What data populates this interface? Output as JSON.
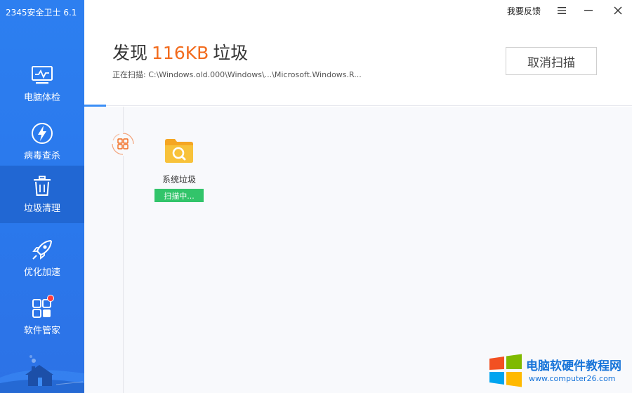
{
  "app": {
    "title": "2345安全卫士 6.1"
  },
  "sidebar": {
    "items": [
      {
        "label": "电脑体检",
        "icon": "monitor-icon",
        "active": false
      },
      {
        "label": "病毒查杀",
        "icon": "lightning-shield-icon",
        "active": false
      },
      {
        "label": "垃圾清理",
        "icon": "trash-icon",
        "active": true
      },
      {
        "label": "优化加速",
        "icon": "rocket-icon",
        "active": false
      },
      {
        "label": "软件管家",
        "icon": "apps-icon",
        "active": false,
        "badge": "red-dot"
      }
    ]
  },
  "titlebar": {
    "feedback": "我要反馈",
    "menu_icon": "hamburger-icon",
    "minimize_icon": "minimize-icon",
    "close_icon": "close-icon"
  },
  "header": {
    "prefix": "发现",
    "size": "116KB",
    "suffix": "垃圾",
    "scan_path": "正在扫描: C:\\Windows.old.000\\Windows\\...\\Microsoft.Windows.R...",
    "cancel_button": "取消扫描"
  },
  "progress": {
    "percent": 4
  },
  "categories": [
    {
      "label": "系统垃圾",
      "status": "扫描中...",
      "icon": "folder-search-icon"
    }
  ],
  "colors": {
    "sidebar": "#2d7ff0",
    "sidebar_active": "#2167d3",
    "accent_orange": "#f26b1d",
    "progress_blue": "#3a8ef6",
    "status_green": "#32c46a"
  },
  "watermark": {
    "title": "电脑软硬件教程网",
    "url": "www.computer26.com"
  }
}
